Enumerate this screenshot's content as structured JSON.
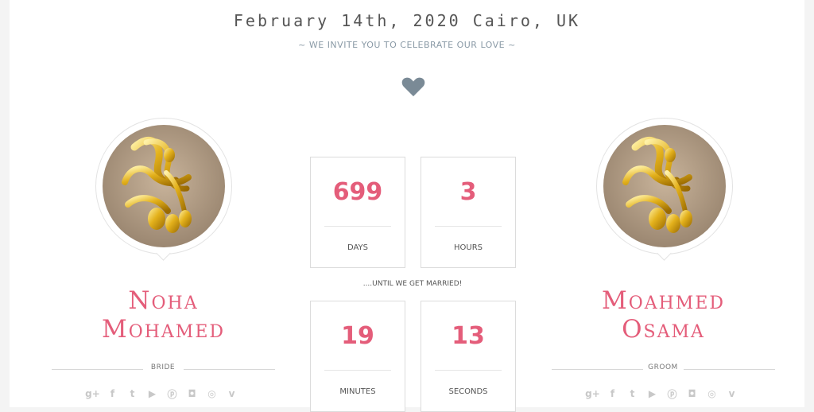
{
  "header": {
    "date_location": "February 14th, 2020 Cairo, UK",
    "invite_text": "~ WE INVITE YOU TO CELEBRATE OUR LOVE ~"
  },
  "bride": {
    "name_line1": "Noha",
    "name_line2": "Mohamed",
    "role": "BRIDE"
  },
  "groom": {
    "name_line1": "Moahmed",
    "name_line2": "Osama",
    "role": "GROOM"
  },
  "countdown": {
    "days": {
      "value": "699",
      "label": "DAYS"
    },
    "hours": {
      "value": "3",
      "label": "HOURS"
    },
    "minutes": {
      "value": "19",
      "label": "MINUTES"
    },
    "seconds": {
      "value": "13",
      "label": "SECONDS"
    },
    "until_text": "....UNTIL WE GET MARRIED!"
  },
  "social_icons": [
    "google-plus-icon",
    "facebook-icon",
    "twitter-icon",
    "youtube-icon",
    "pinterest-icon",
    "instagram-icon",
    "dribbble-icon",
    "vimeo-icon"
  ],
  "colors": {
    "accent": "#e45d7a",
    "heart": "#7a8a96",
    "muted_text": "#8a9aa6"
  }
}
